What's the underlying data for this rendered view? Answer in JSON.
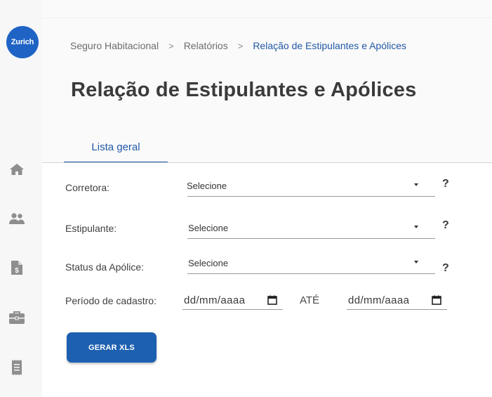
{
  "brand": {
    "logo_text": "Zurich",
    "primary_color": "#1f63c4"
  },
  "sidebar": {
    "items": [
      {
        "icon": "home-icon"
      },
      {
        "icon": "users-icon"
      },
      {
        "icon": "document-dollar-icon"
      },
      {
        "icon": "briefcase-icon"
      },
      {
        "icon": "receipt-icon"
      }
    ]
  },
  "breadcrumb": {
    "items": [
      "Seguro Habitacional",
      "Relatórios",
      "Relação de Estipulantes e Apólices"
    ],
    "separator": ">"
  },
  "page": {
    "title": "Relação de Estipulantes e Apólices"
  },
  "tabs": [
    {
      "label": "Lista geral",
      "active": true
    }
  ],
  "form": {
    "corretora": {
      "label": "Corretora:",
      "value": "Selecione"
    },
    "estipulante": {
      "label": "Estipulante:",
      "value": "Selecione"
    },
    "status": {
      "label": "Status da Apólice:",
      "value": "Selecione"
    },
    "help_symbol": "?",
    "periodo": {
      "label": "Período de cadastro:",
      "from_placeholder": "dd/mm/aaaa",
      "separator": "ATÉ",
      "to_placeholder": "dd/mm/aaaa"
    },
    "submit_label": "GERAR XLS"
  }
}
